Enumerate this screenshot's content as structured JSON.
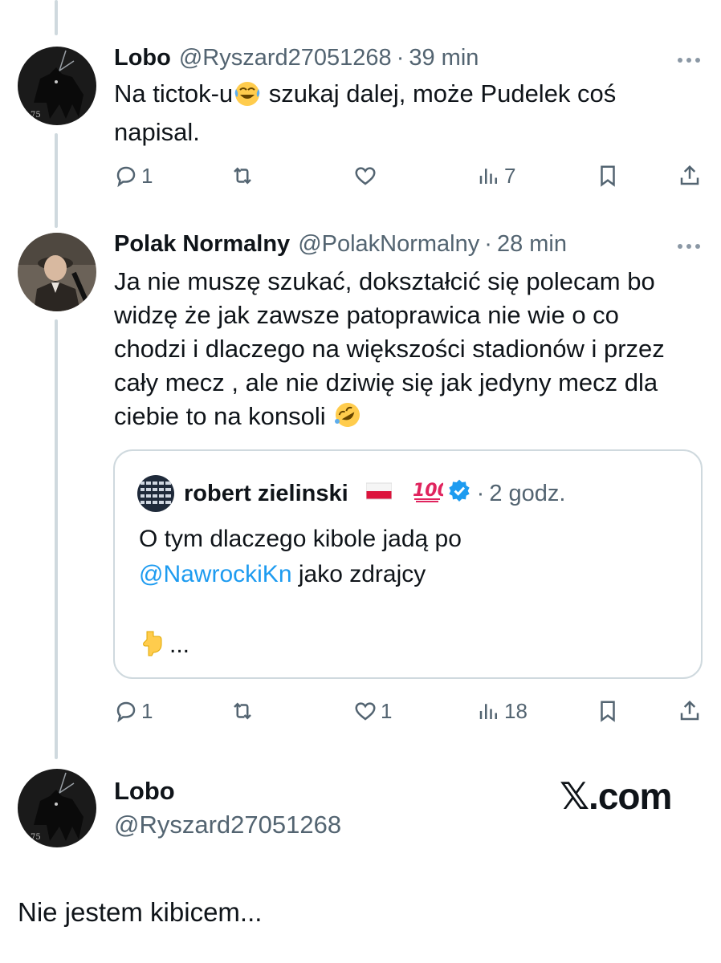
{
  "tweets": [
    {
      "name": "Lobo",
      "handle": "@Ryszard27051268",
      "separator": "·",
      "time": "39 min",
      "text_before": "Na tictok-u",
      "text_after": " szukaj dalej, może Pudelek coś napisal.",
      "emoji": "face-with-tears-of-joy",
      "replies": "1",
      "retweets": "",
      "likes": "",
      "views": "7"
    },
    {
      "name": "Polak Normalny",
      "handle": "@PolakNormalny",
      "separator": "·",
      "time": "28 min",
      "text": "Ja nie muszę szukać, dokształcić się polecam bo widzę że jak zawsze patoprawica nie wie o co chodzi i dlaczego na większości stadionów i przez cały mecz , ale nie dziwię się jak jedyny mecz dla ciebie to na konsoli ",
      "emoji": "rolling-on-the-floor-laughing",
      "replies": "1",
      "retweets": "",
      "likes": "1",
      "views": "18",
      "quote": {
        "name": "robert zielinski",
        "flag": "polish-flag",
        "badge": "hundred-points-emoji",
        "verified": "verified-check",
        "separator": "·",
        "time": "2 godz.",
        "text_line1": "O tym dlaczego kibole jadą po",
        "mention": "@NawrockiKn",
        "text_line2_after": " jako zdrajcy",
        "ellipsis": "...",
        "pointing_emoji": "backhand-index-pointing-down"
      }
    }
  ],
  "final": {
    "name": "Lobo",
    "handle": "@Ryszard27051268",
    "text": "Nie jestem kibicem..."
  },
  "watermark": "𝕏.com",
  "colors": {
    "text": "#0f1419",
    "secondary": "#536471",
    "link": "#1d9bf0",
    "line": "#cfd9de",
    "verified": "#1d9bf0"
  }
}
